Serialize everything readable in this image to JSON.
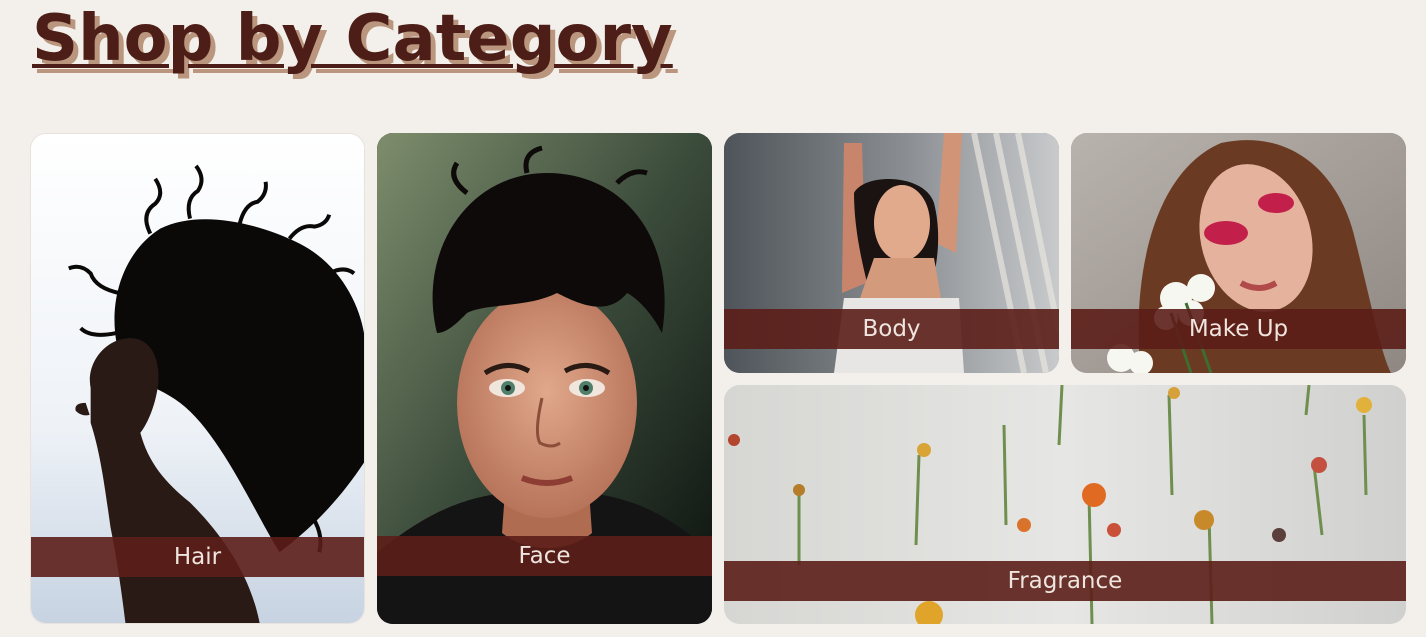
{
  "page": {
    "title": "Shop by Category"
  },
  "categories": [
    {
      "label": "Hair"
    },
    {
      "label": "Face"
    },
    {
      "label": "Body"
    },
    {
      "label": "Make Up"
    },
    {
      "label": "Fragrance"
    }
  ],
  "colors": {
    "background": "#f3f0eb",
    "title": "#4d1e17",
    "title_shadow": "#b9967d",
    "label_bar": "#5c1e18",
    "label_text": "#efe4de"
  }
}
